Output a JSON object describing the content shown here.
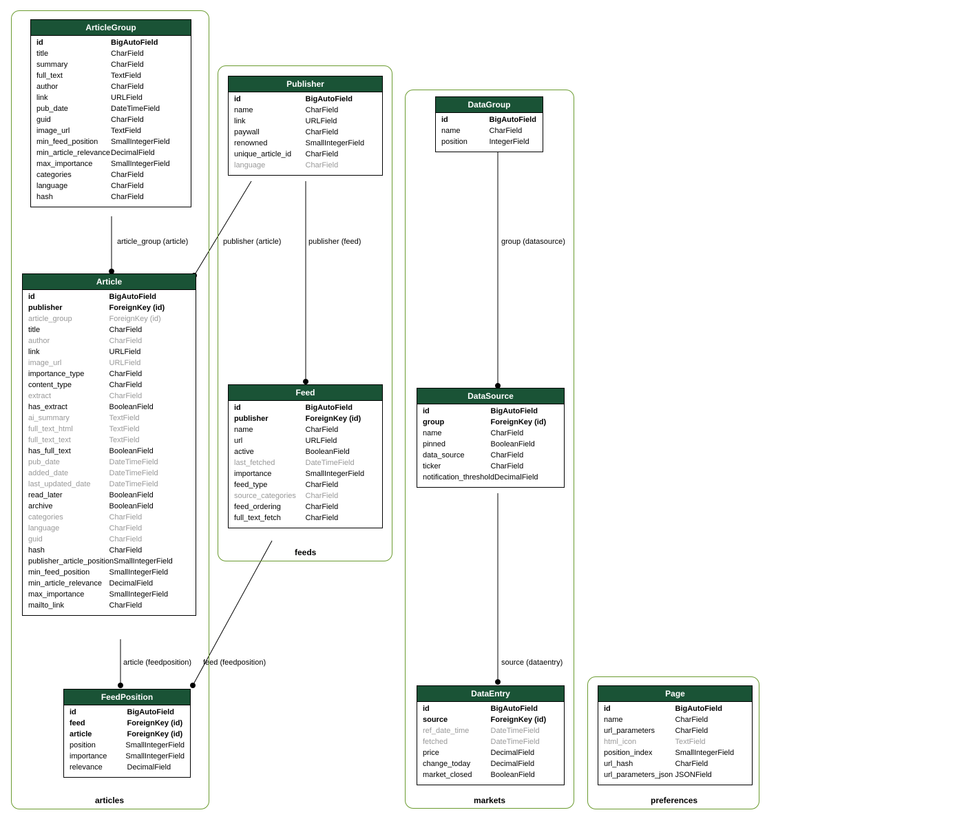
{
  "containers": {
    "articles": {
      "label": "articles"
    },
    "feeds": {
      "label": "feeds"
    },
    "markets": {
      "label": "markets"
    },
    "preferences": {
      "label": "preferences"
    }
  },
  "entities": {
    "ArticleGroup": {
      "title": "ArticleGroup",
      "rows": [
        {
          "name": "id",
          "type": "BigAutoField",
          "bold": true
        },
        {
          "name": "title",
          "type": "CharField"
        },
        {
          "name": "summary",
          "type": "CharField"
        },
        {
          "name": "full_text",
          "type": "TextField"
        },
        {
          "name": "author",
          "type": "CharField"
        },
        {
          "name": "link",
          "type": "URLField"
        },
        {
          "name": "pub_date",
          "type": "DateTimeField"
        },
        {
          "name": "guid",
          "type": "CharField"
        },
        {
          "name": "image_url",
          "type": "TextField"
        },
        {
          "name": "min_feed_position",
          "type": "SmallIntegerField"
        },
        {
          "name": "min_article_relevance",
          "type": "DecimalField"
        },
        {
          "name": "max_importance",
          "type": "SmallIntegerField"
        },
        {
          "name": "categories",
          "type": "CharField"
        },
        {
          "name": "language",
          "type": "CharField"
        },
        {
          "name": "hash",
          "type": "CharField"
        }
      ]
    },
    "Article": {
      "title": "Article",
      "rows": [
        {
          "name": "id",
          "type": "BigAutoField",
          "bold": true
        },
        {
          "name": "publisher",
          "type": "ForeignKey (id)",
          "bold": true
        },
        {
          "name": "article_group",
          "type": "ForeignKey (id)",
          "dim": true
        },
        {
          "name": "title",
          "type": "CharField"
        },
        {
          "name": "author",
          "type": "CharField",
          "dim": true
        },
        {
          "name": "link",
          "type": "URLField"
        },
        {
          "name": "image_url",
          "type": "URLField",
          "dim": true
        },
        {
          "name": "importance_type",
          "type": "CharField"
        },
        {
          "name": "content_type",
          "type": "CharField"
        },
        {
          "name": "extract",
          "type": "CharField",
          "dim": true
        },
        {
          "name": "has_extract",
          "type": "BooleanField"
        },
        {
          "name": "ai_summary",
          "type": "TextField",
          "dim": true
        },
        {
          "name": "full_text_html",
          "type": "TextField",
          "dim": true
        },
        {
          "name": "full_text_text",
          "type": "TextField",
          "dim": true
        },
        {
          "name": "has_full_text",
          "type": "BooleanField"
        },
        {
          "name": "pub_date",
          "type": "DateTimeField",
          "dim": true
        },
        {
          "name": "added_date",
          "type": "DateTimeField",
          "dim": true
        },
        {
          "name": "last_updated_date",
          "type": "DateTimeField",
          "dim": true
        },
        {
          "name": "read_later",
          "type": "BooleanField"
        },
        {
          "name": "archive",
          "type": "BooleanField"
        },
        {
          "name": "categories",
          "type": "CharField",
          "dim": true
        },
        {
          "name": "language",
          "type": "CharField",
          "dim": true
        },
        {
          "name": "guid",
          "type": "CharField",
          "dim": true
        },
        {
          "name": "hash",
          "type": "CharField"
        },
        {
          "name": "publisher_article_position",
          "type": "SmallIntegerField"
        },
        {
          "name": "min_feed_position",
          "type": "SmallIntegerField"
        },
        {
          "name": "min_article_relevance",
          "type": "DecimalField"
        },
        {
          "name": "max_importance",
          "type": "SmallIntegerField"
        },
        {
          "name": "mailto_link",
          "type": "CharField"
        }
      ]
    },
    "FeedPosition": {
      "title": "FeedPosition",
      "rows": [
        {
          "name": "id",
          "type": "BigAutoField",
          "bold": true
        },
        {
          "name": "feed",
          "type": "ForeignKey (id)",
          "bold": true
        },
        {
          "name": "article",
          "type": "ForeignKey (id)",
          "bold": true
        },
        {
          "name": "position",
          "type": "SmallIntegerField"
        },
        {
          "name": "importance",
          "type": "SmallIntegerField"
        },
        {
          "name": "relevance",
          "type": "DecimalField"
        }
      ]
    },
    "Publisher": {
      "title": "Publisher",
      "rows": [
        {
          "name": "id",
          "type": "BigAutoField",
          "bold": true
        },
        {
          "name": "name",
          "type": "CharField"
        },
        {
          "name": "link",
          "type": "URLField"
        },
        {
          "name": "paywall",
          "type": "CharField"
        },
        {
          "name": "renowned",
          "type": "SmallIntegerField"
        },
        {
          "name": "unique_article_id",
          "type": "CharField"
        },
        {
          "name": "language",
          "type": "CharField",
          "dim": true
        }
      ]
    },
    "Feed": {
      "title": "Feed",
      "rows": [
        {
          "name": "id",
          "type": "BigAutoField",
          "bold": true
        },
        {
          "name": "publisher",
          "type": "ForeignKey (id)",
          "bold": true
        },
        {
          "name": "name",
          "type": "CharField"
        },
        {
          "name": "url",
          "type": "URLField"
        },
        {
          "name": "active",
          "type": "BooleanField"
        },
        {
          "name": "last_fetched",
          "type": "DateTimeField",
          "dim": true
        },
        {
          "name": "importance",
          "type": "SmallIntegerField"
        },
        {
          "name": "feed_type",
          "type": "CharField"
        },
        {
          "name": "source_categories",
          "type": "CharField",
          "dim": true
        },
        {
          "name": "feed_ordering",
          "type": "CharField"
        },
        {
          "name": "full_text_fetch",
          "type": "CharField"
        }
      ]
    },
    "DataGroup": {
      "title": "DataGroup",
      "rows": [
        {
          "name": "id",
          "type": "BigAutoField",
          "bold": true
        },
        {
          "name": "name",
          "type": "CharField"
        },
        {
          "name": "position",
          "type": "IntegerField"
        }
      ]
    },
    "DataSource": {
      "title": "DataSource",
      "rows": [
        {
          "name": "id",
          "type": "BigAutoField",
          "bold": true
        },
        {
          "name": "group",
          "type": "ForeignKey (id)",
          "bold": true
        },
        {
          "name": "name",
          "type": "CharField"
        },
        {
          "name": "pinned",
          "type": "BooleanField"
        },
        {
          "name": "data_source",
          "type": "CharField"
        },
        {
          "name": "ticker",
          "type": "CharField"
        },
        {
          "name": "notification_threshold",
          "type": "DecimalField"
        }
      ]
    },
    "DataEntry": {
      "title": "DataEntry",
      "rows": [
        {
          "name": "id",
          "type": "BigAutoField",
          "bold": true
        },
        {
          "name": "source",
          "type": "ForeignKey (id)",
          "bold": true
        },
        {
          "name": "ref_date_time",
          "type": "DateTimeField",
          "dim": true
        },
        {
          "name": "fetched",
          "type": "DateTimeField",
          "dim": true
        },
        {
          "name": "price",
          "type": "DecimalField"
        },
        {
          "name": "change_today",
          "type": "DecimalField"
        },
        {
          "name": "market_closed",
          "type": "BooleanField"
        }
      ]
    },
    "Page": {
      "title": "Page",
      "rows": [
        {
          "name": "id",
          "type": "BigAutoField",
          "bold": true
        },
        {
          "name": "name",
          "type": "CharField"
        },
        {
          "name": "url_parameters",
          "type": "CharField"
        },
        {
          "name": "html_icon",
          "type": "TextField",
          "dim": true
        },
        {
          "name": "position_index",
          "type": "SmallIntegerField"
        },
        {
          "name": "url_hash",
          "type": "CharField"
        },
        {
          "name": "url_parameters_json",
          "type": "JSONField"
        }
      ]
    }
  },
  "relations": {
    "ag_to_article": "article_group (article)",
    "pub_to_article": "publisher (article)",
    "pub_to_feed": "publisher (feed)",
    "feed_to_fp": "feed (feedposition)",
    "article_to_fp": "article (feedposition)",
    "dg_to_ds": "group (datasource)",
    "ds_to_de": "source (dataentry)"
  }
}
